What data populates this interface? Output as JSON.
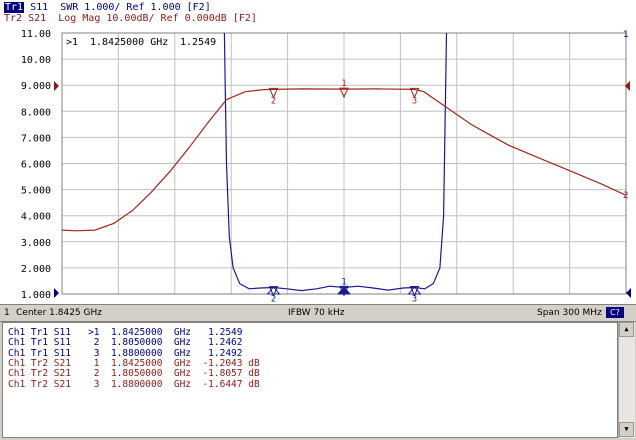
{
  "header": {
    "trace1": {
      "badge": "Tr1",
      "text": "S11  SWR 1.000/ Ref 1.000 [F2]"
    },
    "trace2": {
      "badge": "Tr2",
      "text": "S21  Log Mag 10.00dB/ Ref 0.000dB [F2]"
    }
  },
  "active_marker_readout": {
    "marker": ">1",
    "freq": "1.8425000 GHz",
    "value": "1.2549"
  },
  "status_bar": {
    "channel": "1",
    "center": "Center 1.8425 GHz",
    "ifbw": "IFBW 70 kHz",
    "span": "Span 300 MHz",
    "button": "C?"
  },
  "colors": {
    "trace_swr": "#1a1a8c",
    "trace_s21": "#a0281e",
    "grid": "#c0c0c0"
  },
  "chart_data": {
    "type": "line",
    "x_label": "",
    "x": [
      1.6925,
      1.7,
      1.71,
      1.72,
      1.73,
      1.74,
      1.75,
      1.76,
      1.77,
      1.78,
      1.79,
      1.8,
      1.805,
      1.81,
      1.82,
      1.83,
      1.8425,
      1.85,
      1.86,
      1.87,
      1.88,
      1.89,
      1.9,
      1.91,
      1.92,
      1.93,
      1.94,
      1.95,
      1.96,
      1.97,
      1.98,
      1.9925
    ],
    "y_ticks": [
      "11.00",
      "10.00",
      "9.000",
      "8.000",
      "7.000",
      "6.000",
      "5.000",
      "4.000",
      "3.000",
      "2.000",
      "1.000"
    ],
    "ylim": [
      1.0,
      11.0
    ],
    "series": [
      {
        "name": "S11",
        "x": [
          1.7789,
          1.7793,
          1.78,
          1.7815,
          1.7835,
          1.787,
          1.792,
          1.798,
          1.805,
          1.812,
          1.82,
          1.828,
          1.835,
          1.8425,
          1.85,
          1.858,
          1.866,
          1.874,
          1.88,
          1.8855,
          1.89,
          1.8935,
          1.8955,
          1.897
        ],
        "values": [
          11.0,
          9.0,
          6.0,
          3.2,
          2.0,
          1.4,
          1.2,
          1.23,
          1.25,
          1.2,
          1.13,
          1.2,
          1.3,
          1.25,
          1.3,
          1.23,
          1.15,
          1.23,
          1.25,
          1.2,
          1.4,
          2.0,
          4.0,
          11.0
        ]
      },
      {
        "name": "S21",
        "x": [
          1.6925,
          1.7,
          1.71,
          1.72,
          1.73,
          1.74,
          1.75,
          1.76,
          1.77,
          1.775,
          1.78,
          1.79,
          1.8,
          1.805,
          1.82,
          1.8425,
          1.86,
          1.88,
          1.885,
          1.89,
          1.9,
          1.91,
          1.92,
          1.93,
          1.94,
          1.95,
          1.96,
          1.97,
          1.98,
          1.9925
        ],
        "values": [
          3.45,
          3.42,
          3.45,
          3.7,
          4.2,
          4.9,
          5.7,
          6.6,
          7.55,
          8.0,
          8.45,
          8.75,
          8.83,
          8.84,
          8.86,
          8.85,
          8.86,
          8.84,
          8.75,
          8.5,
          8.0,
          7.5,
          7.1,
          6.7,
          6.4,
          6.1,
          5.8,
          5.5,
          5.2,
          4.78
        ]
      }
    ],
    "markers": [
      {
        "trace": "Tr2",
        "label": "1",
        "x": 1.8425,
        "y": 8.85
      },
      {
        "trace": "Tr2",
        "label": "2",
        "x": 1.805,
        "y": 8.84
      },
      {
        "trace": "Tr2",
        "label": "3",
        "x": 1.88,
        "y": 8.84
      },
      {
        "trace": "Tr1",
        "label": "1",
        "x": 1.8425,
        "y": 1.2549
      },
      {
        "trace": "Tr1",
        "label": "2",
        "x": 1.805,
        "y": 1.2462
      },
      {
        "trace": "Tr1",
        "label": "3",
        "x": 1.88,
        "y": 1.2492
      }
    ],
    "ref_labels": {
      "tr1": "1",
      "tr2": "2"
    }
  },
  "marker_table": {
    "rows": [
      {
        "ch": "Ch1",
        "tr": "Tr1",
        "param": "S11",
        "mk": ">1",
        "freq": "1.8425000",
        "unit": "GHz",
        "val": "1.2549",
        "vunit": "",
        "color": "#000080"
      },
      {
        "ch": "Ch1",
        "tr": "Tr1",
        "param": "S11",
        "mk": "2",
        "freq": "1.8050000",
        "unit": "GHz",
        "val": "1.2462",
        "vunit": "",
        "color": "#000080"
      },
      {
        "ch": "Ch1",
        "tr": "Tr1",
        "param": "S11",
        "mk": "3",
        "freq": "1.8800000",
        "unit": "GHz",
        "val": "1.2492",
        "vunit": "",
        "color": "#000080"
      },
      {
        "ch": "Ch1",
        "tr": "Tr2",
        "param": "S21",
        "mk": "1",
        "freq": "1.8425000",
        "unit": "GHz",
        "val": "-1.2043",
        "vunit": "dB",
        "color": "#8b1a1a"
      },
      {
        "ch": "Ch1",
        "tr": "Tr2",
        "param": "S21",
        "mk": "2",
        "freq": "1.8050000",
        "unit": "GHz",
        "val": "-1.8057",
        "vunit": "dB",
        "color": "#8b1a1a"
      },
      {
        "ch": "Ch1",
        "tr": "Tr2",
        "param": "S21",
        "mk": "3",
        "freq": "1.8800000",
        "unit": "GHz",
        "val": "-1.6447",
        "vunit": "dB",
        "color": "#8b1a1a"
      }
    ]
  }
}
